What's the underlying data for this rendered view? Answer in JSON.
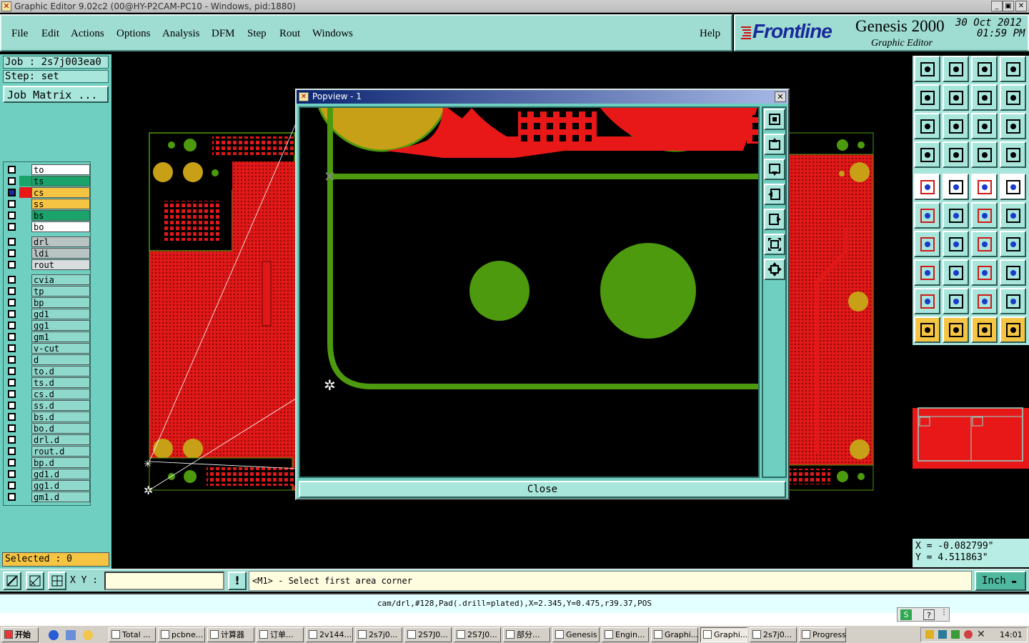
{
  "window": {
    "title": "Graphic Editor 9.02c2 (00@HY-P2CAM-PC10 - Windows, pid:1880)",
    "min": "_",
    "max": "▣",
    "close": "✕"
  },
  "menu": {
    "items": [
      "File",
      "Edit",
      "Actions",
      "Options",
      "Analysis",
      "DFM",
      "Step",
      "Rout",
      "Windows"
    ],
    "help": "Help"
  },
  "brand": {
    "logo": "Frontline",
    "product": "Genesis 2000",
    "subtitle": "Graphic Editor",
    "date": "30 Oct 2012",
    "time": "01:59 PM"
  },
  "job": {
    "job_label": "Job : 2s7j003ea0",
    "step_label": "Step: set",
    "matrix_button": "Job Matrix ..."
  },
  "layers": [
    {
      "name": "to",
      "color": "#ffffff"
    },
    {
      "name": "ts",
      "color": "#1aa36a"
    },
    {
      "name": "cs",
      "color": "#f5c443"
    },
    {
      "name": "ss",
      "color": "#f5c443"
    },
    {
      "name": "bs",
      "color": "#1aa36a"
    },
    {
      "name": "bo",
      "color": "#ffffff"
    },
    {
      "name": "drl",
      "color": "#b8c4c2"
    },
    {
      "name": "ldi",
      "color": "#b8c4c2"
    },
    {
      "name": "rout",
      "color": "#d7dedd"
    },
    {
      "name": "cvia",
      "color": "#8fd8cc"
    },
    {
      "name": "tp",
      "color": "#8fd8cc"
    },
    {
      "name": "bp",
      "color": "#8fd8cc"
    },
    {
      "name": "gd1",
      "color": "#8fd8cc"
    },
    {
      "name": "gg1",
      "color": "#8fd8cc"
    },
    {
      "name": "gm1",
      "color": "#8fd8cc"
    },
    {
      "name": "v-cut",
      "color": "#8fd8cc"
    },
    {
      "name": "d",
      "color": "#8fd8cc"
    },
    {
      "name": "to.d",
      "color": "#8fd8cc"
    },
    {
      "name": "ts.d",
      "color": "#8fd8cc"
    },
    {
      "name": "cs.d",
      "color": "#8fd8cc"
    },
    {
      "name": "ss.d",
      "color": "#8fd8cc"
    },
    {
      "name": "bs.d",
      "color": "#8fd8cc"
    },
    {
      "name": "bo.d",
      "color": "#8fd8cc"
    },
    {
      "name": "drl.d",
      "color": "#8fd8cc"
    },
    {
      "name": "rout.d",
      "color": "#8fd8cc"
    },
    {
      "name": "bp.d",
      "color": "#8fd8cc"
    },
    {
      "name": "gd1.d",
      "color": "#8fd8cc"
    },
    {
      "name": "gg1.d",
      "color": "#8fd8cc"
    },
    {
      "name": "gm1.d",
      "color": "#8fd8cc"
    }
  ],
  "selected_label": "Selected : 0",
  "popup": {
    "title": "Popview - 1",
    "close_button": "Close"
  },
  "coords": {
    "x": "X = -0.082799\"",
    "y": "Y = 4.511863\""
  },
  "bottom": {
    "xy_label": "X Y :",
    "prompt": "<M1> - Select first area corner",
    "units": "Inch"
  },
  "status": {
    "text": "cam/drl,#128,Pad(.drill=plated),X=2.345,Y=0.475,r39.37,POS"
  },
  "taskbar": {
    "start": "开始",
    "tasks": [
      "Total ...",
      "pcbne...",
      "计算器",
      "订单...",
      "2v144...",
      "2s7j0...",
      "2S7J0...",
      "2S7J0...",
      "部分...",
      "Genesis",
      "Engin...",
      "Graphi...",
      "Graphi...",
      "2s7j0...",
      "Progress"
    ],
    "clock": "14:01"
  },
  "colors": {
    "teal": "#9fdcd2",
    "copper": "#e81818",
    "pad": "#c8a018",
    "green": "#4e9a0e"
  }
}
